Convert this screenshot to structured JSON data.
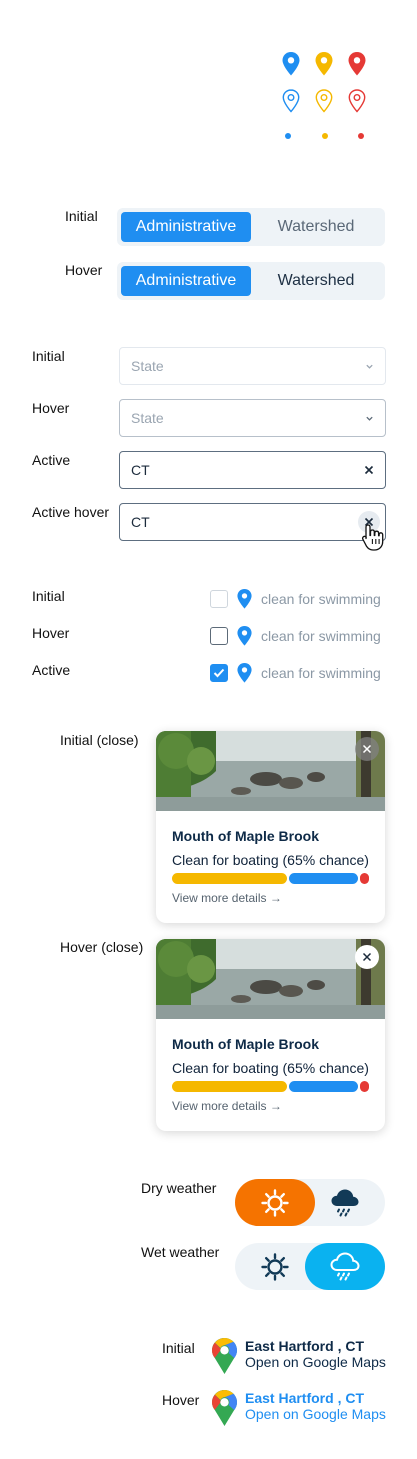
{
  "pins": {
    "colors": [
      "#1f8ef1",
      "#f5b800",
      "#e53935"
    ]
  },
  "segmented": {
    "initial_label": "Initial",
    "hover_label": "Hover",
    "options": [
      "Administrative",
      "Watershed"
    ]
  },
  "select": {
    "initial_label": "Initial",
    "hover_label": "Hover",
    "active_label": "Active",
    "active_hover_label": "Active hover",
    "placeholder": "State",
    "value": "CT"
  },
  "checkbox": {
    "initial_label": "Initial",
    "hover_label": "Hover",
    "active_label": "Active",
    "text": "clean for swimming"
  },
  "card": {
    "initial_label": "Initial (close)",
    "hover_label": "Hover (close)",
    "title": "Mouth of Maple Brook",
    "subtitle": "Clean for boating (65% chance)",
    "link": "View more details →",
    "probability": {
      "clean": 0.65
    }
  },
  "weather": {
    "dry_label": "Dry weather",
    "wet_label": "Wet weather"
  },
  "maps": {
    "initial_label": "Initial",
    "hover_label": "Hover",
    "city": "East Hartford , CT",
    "link": "Open on Google Maps"
  }
}
